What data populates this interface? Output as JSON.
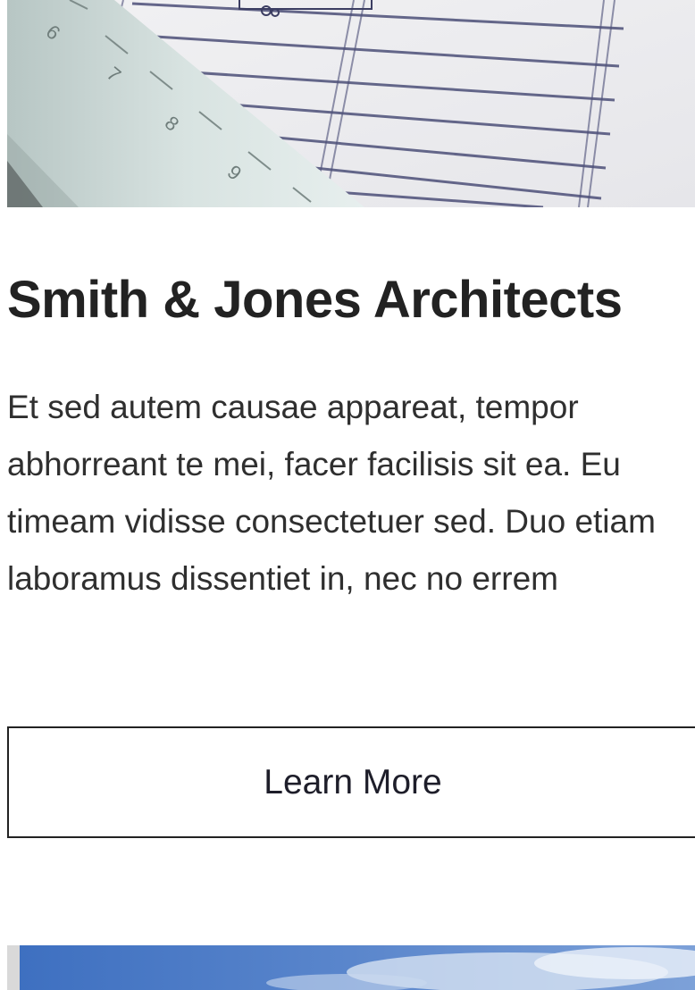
{
  "card": {
    "title": "Smith & Jones Architects",
    "description": "Et sed autem causae appareat, tempor abhorreant te mei, facer facilisis sit ea. Eu timeam vidisse consectetuer sed. Duo etiam laboramus dissentiet in, nec no errem",
    "button_label": "Learn More",
    "image": "architectural-drawing-with-ruler",
    "ruler_numbers": [
      "6",
      "7",
      "8",
      "9"
    ]
  },
  "next_card": {
    "image": "sky-with-clouds"
  },
  "colors": {
    "title": "#222222",
    "body_text": "#2f2f2f",
    "button_border": "#222222",
    "sky": "#4f7fc8"
  }
}
